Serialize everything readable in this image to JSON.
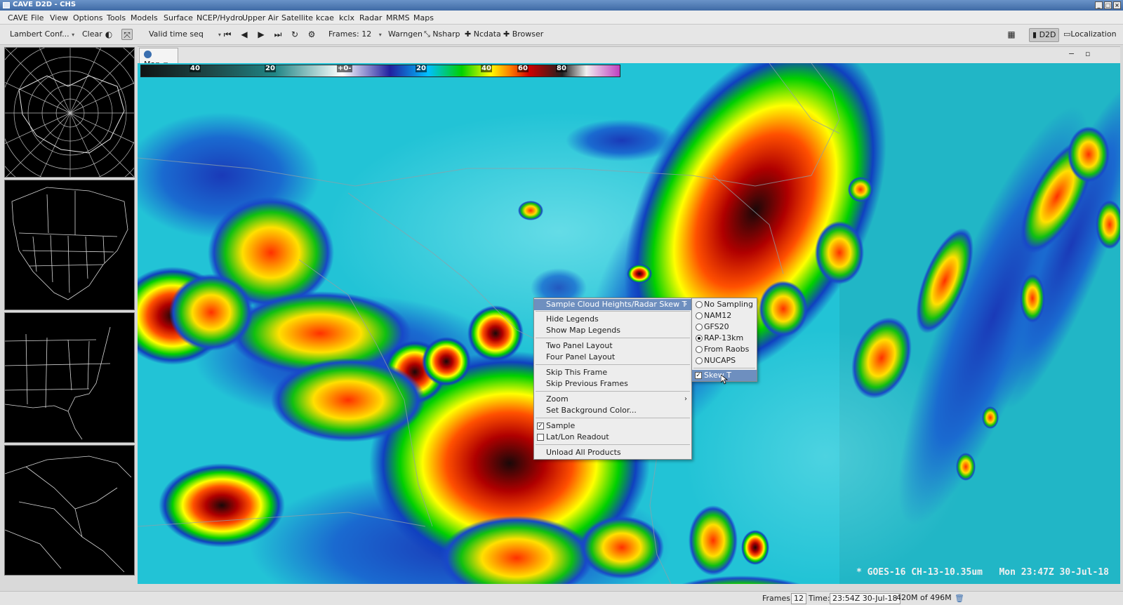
{
  "window": {
    "title": "CAVE D2D - CHS"
  },
  "menubar": [
    "CAVE",
    "File",
    "View",
    "Options",
    "Tools",
    "Models",
    "Surface",
    "NCEP/Hydro",
    "Upper Air",
    "Satellite",
    "kcae",
    "kclx",
    "Radar",
    "MRMS",
    "Maps"
  ],
  "toolbar": {
    "projection": "Lambert Conf...",
    "clear": "Clear",
    "time_mode": "Valid time seq",
    "frames": "Frames: 12",
    "warngen": "Warngen",
    "nsharp": "Nsharp",
    "ncdata": "Ncdata",
    "browser": "Browser",
    "perspective": "D2D",
    "localization": "Localization"
  },
  "map_tab": {
    "label": "Map"
  },
  "colorbar_labels": [
    "40",
    "20",
    "+0-",
    "20",
    "40",
    "60",
    "80"
  ],
  "map_caption": "* GOES-16 CH-13-10.35um   Mon 23:47Z 30-Jul-18",
  "context_menu": {
    "items": [
      {
        "label": "Sample Cloud Heights/Radar Skew T",
        "submenu": true,
        "highlighted": true
      },
      {
        "label": "Hide Legends"
      },
      {
        "label": "Show Map Legends"
      },
      {
        "label": "Two Panel Layout"
      },
      {
        "label": "Four Panel Layout"
      },
      {
        "label": "Skip This Frame"
      },
      {
        "label": "Skip Previous Frames"
      },
      {
        "label": "Zoom",
        "submenu": true
      },
      {
        "label": "Set Background Color..."
      },
      {
        "label": "Sample",
        "checked": true
      },
      {
        "label": "Lat/Lon Readout",
        "checked": false
      },
      {
        "label": "Unload All Products"
      }
    ]
  },
  "submenu": {
    "options": [
      {
        "label": "No Sampling",
        "selected": false
      },
      {
        "label": "NAM12",
        "selected": false
      },
      {
        "label": "GFS20",
        "selected": false
      },
      {
        "label": "RAP-13km",
        "selected": true
      },
      {
        "label": "From Raobs",
        "selected": false
      },
      {
        "label": "NUCAPS",
        "selected": false
      }
    ],
    "skewt": {
      "label": "Skew T",
      "checked": true
    }
  },
  "statusbar": {
    "frames_label": "Frames:",
    "frames_value": "12",
    "time_label": "Time:",
    "time_value": "23:54Z 30-Jul-18",
    "memory": "420M of 496M"
  }
}
